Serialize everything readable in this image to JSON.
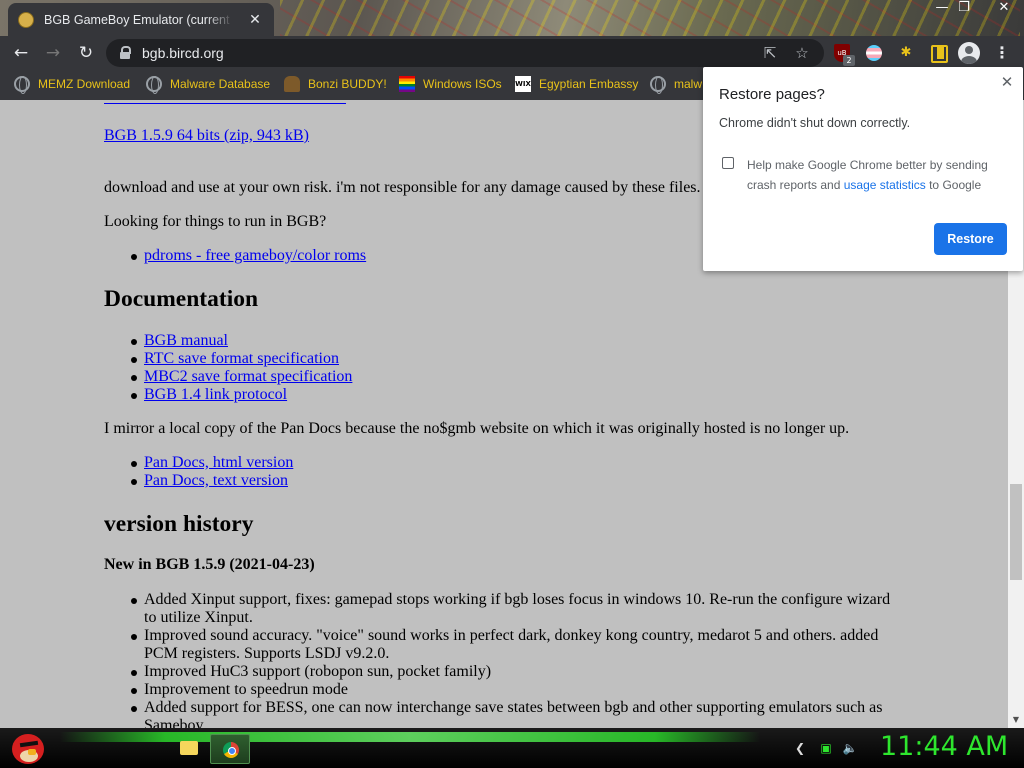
{
  "tab": {
    "title": "BGB GameBoy Emulator (current",
    "close": "✕",
    "favicon": "bgb-icon"
  },
  "window": {
    "minimize": "—",
    "maximize": "❐",
    "close": "✕"
  },
  "toolbar": {
    "url": "bgb.bircd.org",
    "ublock_badge": "2",
    "ublock_label": "uB"
  },
  "bookmarks": [
    {
      "label": "MEMZ Download",
      "icon": "globe-icon"
    },
    {
      "label": "Malware Database",
      "icon": "globe-icon"
    },
    {
      "label": "Bonzi BUDDY!",
      "icon": "bonzi-icon"
    },
    {
      "label": "Windows ISOs",
      "icon": "rainbow-flag-icon"
    },
    {
      "label": "Egyptian Embassy",
      "icon": "wix-icon"
    },
    {
      "label": "malw",
      "icon": "globe-icon"
    }
  ],
  "page": {
    "download_64": "BGB 1.5.9 64 bits (zip, 943 kB)",
    "disclaimer": "download and use at your own risk. i'm not responsible for any damage caused by these files.",
    "looking": "Looking for things to run in BGB?",
    "pdroms": "pdroms - free gameboy/color roms",
    "doc_heading": "Documentation",
    "doc_links": [
      "BGB manual",
      "RTC save format specification",
      "MBC2 save format specification",
      "BGB 1.4 link protocol"
    ],
    "mirror_text": "I mirror a local copy of the Pan Docs because the no$gmb website on which it was originally hosted is no longer up.",
    "pandocs_links": [
      "Pan Docs, html version",
      "Pan Docs, text version"
    ],
    "history_heading": "version history",
    "new_in": "New in BGB 1.5.9 (2021-04-23)",
    "changes": [
      [
        "Added Xinput support, fixes: gamepad stops working if bgb loses focus in windows 10. Re-run the configure wizard",
        "to utilize Xinput."
      ],
      [
        "Improved sound accuracy. \"voice\" sound works in perfect dark, donkey kong country, medarot 5 and others. added",
        "PCM registers. Supports LSDJ v9.2.0."
      ],
      [
        "Improved HuC3 support (robopon sun, pocket family)"
      ],
      [
        "Improvement to speedrun mode"
      ],
      [
        "Added support for BESS, one can now interchange save states between bgb and other supporting emulators such as",
        "Sameboy."
      ]
    ]
  },
  "restore": {
    "title": "Restore pages?",
    "message": "Chrome didn't shut down correctly.",
    "help_pre": "Help make Google Chrome better by sending crash reports and ",
    "help_link": "usage statistics",
    "help_post": " to Google",
    "checked": false,
    "button": "Restore",
    "close": "✕"
  },
  "taskbar": {
    "clock": "11:44 AM"
  },
  "colors": {
    "link": "#0000ee",
    "page_bg": "#c0c0c0",
    "accent": "#1a73e8",
    "clock": "#2ee62e",
    "bookmark_text": "#e8c21a"
  }
}
